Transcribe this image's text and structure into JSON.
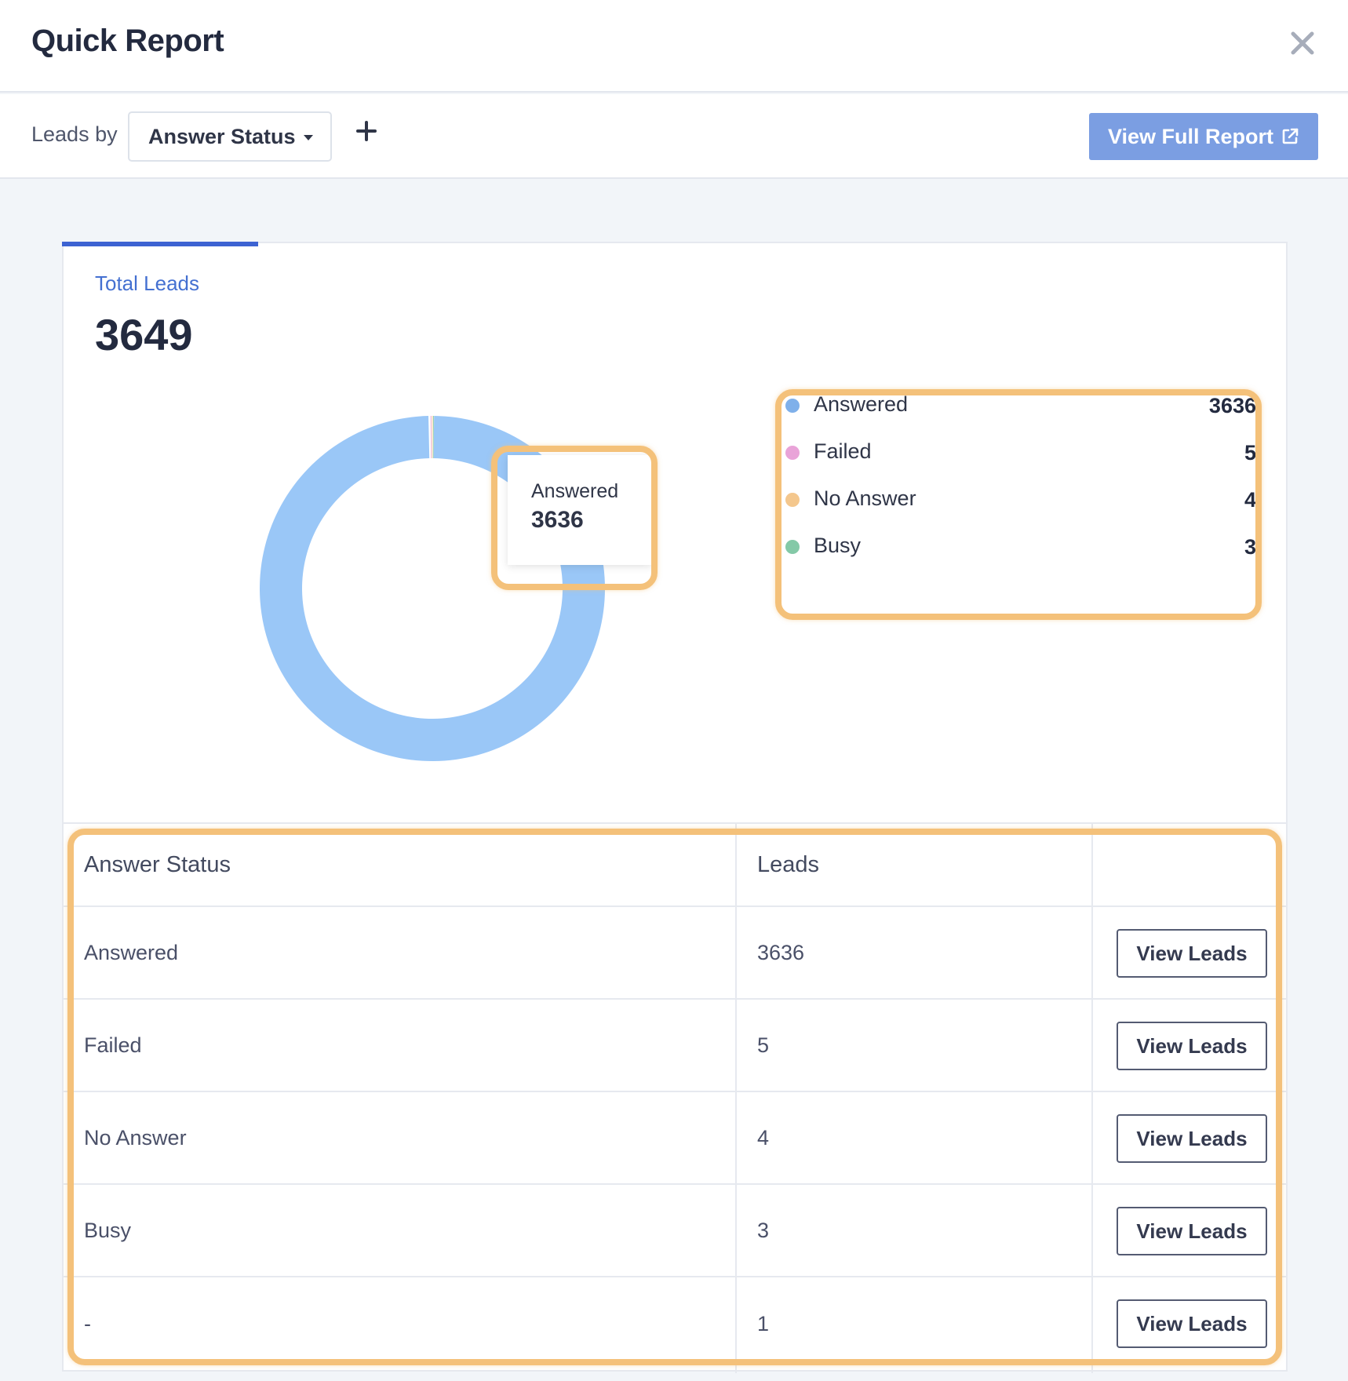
{
  "header": {
    "title": "Quick Report"
  },
  "toolbar": {
    "leads_by_label": "Leads by",
    "group_by_value": "Answer Status",
    "view_full_report_label": "View Full Report"
  },
  "summary": {
    "label": "Total Leads",
    "value": "3649"
  },
  "tooltip": {
    "label": "Answered",
    "value": "3636"
  },
  "colors": {
    "answered": "#7fb0ea",
    "failed": "#e9a3d8",
    "no_answer": "#f4c78d",
    "busy": "#84c9a7",
    "highlight": "#f4c17a",
    "accent": "#3d63d2"
  },
  "legend": [
    {
      "name": "Answered",
      "count": "3636",
      "color": "#7fb0ea"
    },
    {
      "name": "Failed",
      "count": "5",
      "color": "#e9a3d8"
    },
    {
      "name": "No Answer",
      "count": "4",
      "color": "#f4c78d"
    },
    {
      "name": "Busy",
      "count": "3",
      "color": "#84c9a7"
    }
  ],
  "table": {
    "headers": [
      "Answer Status",
      "Leads"
    ],
    "rows": [
      {
        "status": "Answered",
        "leads": "3636",
        "action": "View Leads"
      },
      {
        "status": "Failed",
        "leads": "5",
        "action": "View Leads"
      },
      {
        "status": "No Answer",
        "leads": "4",
        "action": "View Leads"
      },
      {
        "status": "Busy",
        "leads": "3",
        "action": "View Leads"
      },
      {
        "status": "-",
        "leads": "1",
        "action": "View Leads"
      }
    ]
  },
  "chart_data": {
    "type": "pie",
    "categories": [
      "Answered",
      "Failed",
      "No Answer",
      "Busy"
    ],
    "values": [
      3636,
      5,
      4,
      3
    ],
    "title": "",
    "legend": "right"
  }
}
